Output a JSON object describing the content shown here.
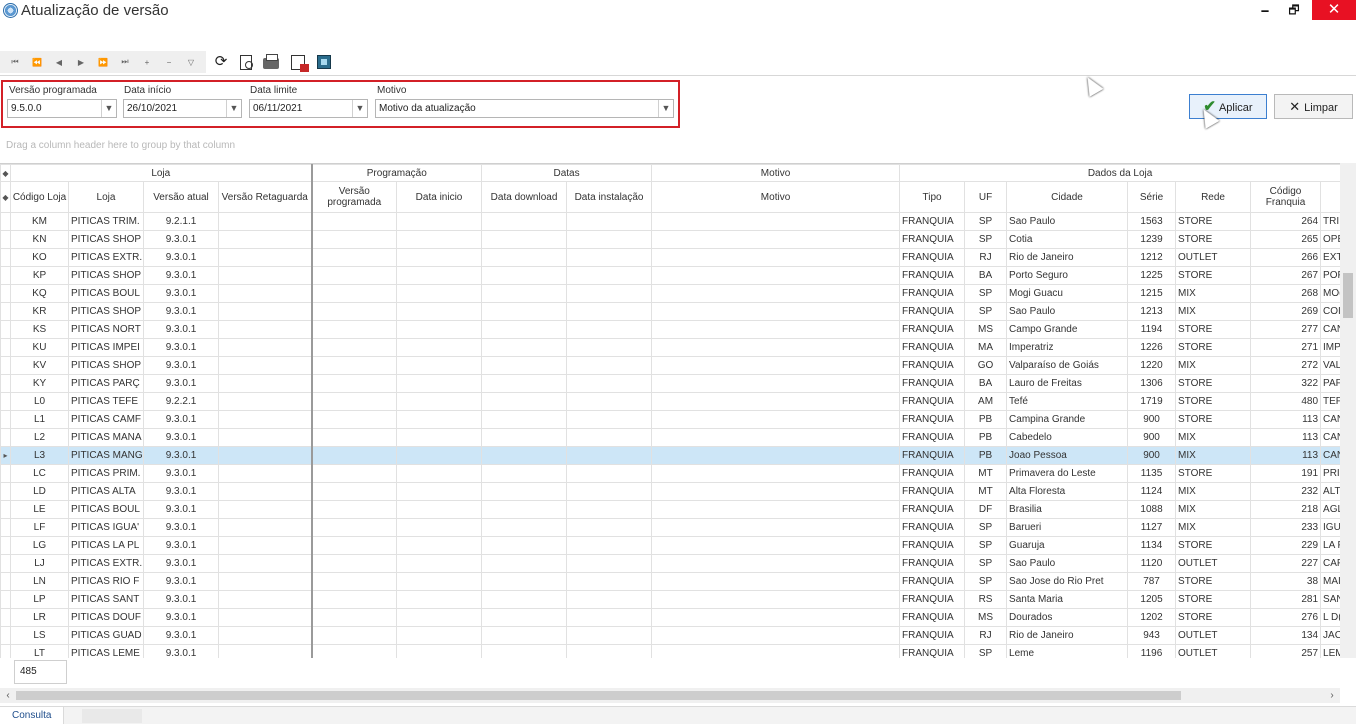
{
  "window": {
    "title": "Atualização de versão",
    "min_glyph": "🗕",
    "max_glyph": "🗗",
    "close_glyph": "✕"
  },
  "toolbar": {
    "nav_buttons": [
      "⏮",
      "⏪",
      "◀",
      "▶",
      "⏩",
      "⏭",
      "+",
      "−",
      "▽"
    ],
    "refresh_glyph": "⟳"
  },
  "filters": {
    "versao_label": "Versão programada",
    "versao_value": "9.5.0.0",
    "data_inicio_label": "Data início",
    "data_inicio_value": "26/10/2021",
    "data_limite_label": "Data limite",
    "data_limite_value": "06/11/2021",
    "motivo_label": "Motivo",
    "motivo_value": "Motivo da atualização"
  },
  "actions": {
    "apply_label": "Aplicar",
    "clear_label": "Limpar"
  },
  "grid": {
    "group_panel_text": "Drag a column header here to group by that column",
    "bands": {
      "loja": "Loja",
      "programacao": "Programação",
      "datas": "Datas",
      "motivo": "Motivo",
      "dados_loja": "Dados da Loja"
    },
    "columns": {
      "codigo_loja": "Código Loja",
      "loja": "Loja",
      "versao_atual": "Versão atual",
      "versao_retaguarda": "Versão Retaguarda",
      "versao_programada": "Versão programada",
      "data_inicio": "Data inicio",
      "data_download": "Data download",
      "data_instalacao": "Data instalação",
      "motivo": "Motivo",
      "tipo": "Tipo",
      "uf": "UF",
      "cidade": "Cidade",
      "serie": "Série",
      "rede": "Rede",
      "codigo_franquia": "Código Franquia"
    },
    "selected_row_index": 13,
    "rows": [
      {
        "codigo": "KM",
        "loja": "PITICAS TRIM.",
        "versao": "9.2.1.1",
        "tipo": "FRANQUIA",
        "uf": "SP",
        "cidade": "Sao Paulo",
        "serie": "1563",
        "rede": "STORE",
        "franquia": "264",
        "extra": "TRI"
      },
      {
        "codigo": "KN",
        "loja": "PITICAS SHOP",
        "versao": "9.3.0.1",
        "tipo": "FRANQUIA",
        "uf": "SP",
        "cidade": "Cotia",
        "serie": "1239",
        "rede": "STORE",
        "franquia": "265",
        "extra": "OPE"
      },
      {
        "codigo": "KO",
        "loja": "PITICAS EXTR.",
        "versao": "9.3.0.1",
        "tipo": "FRANQUIA",
        "uf": "RJ",
        "cidade": "Rio de Janeiro",
        "serie": "1212",
        "rede": "OUTLET",
        "franquia": "266",
        "extra": "EXT"
      },
      {
        "codigo": "KP",
        "loja": "PITICAS SHOP",
        "versao": "9.3.0.1",
        "tipo": "FRANQUIA",
        "uf": "BA",
        "cidade": "Porto Seguro",
        "serie": "1225",
        "rede": "STORE",
        "franquia": "267",
        "extra": "POF"
      },
      {
        "codigo": "KQ",
        "loja": "PITICAS BOUL",
        "versao": "9.3.0.1",
        "tipo": "FRANQUIA",
        "uf": "SP",
        "cidade": "Mogi Guacu",
        "serie": "1215",
        "rede": "MIX",
        "franquia": "268",
        "extra": "MO("
      },
      {
        "codigo": "KR",
        "loja": "PITICAS SHOP",
        "versao": "9.3.0.1",
        "tipo": "FRANQUIA",
        "uf": "SP",
        "cidade": "Sao Paulo",
        "serie": "1213",
        "rede": "MIX",
        "franquia": "269",
        "extra": "COI"
      },
      {
        "codigo": "KS",
        "loja": "PITICAS NORT",
        "versao": "9.3.0.1",
        "tipo": "FRANQUIA",
        "uf": "MS",
        "cidade": "Campo Grande",
        "serie": "1194",
        "rede": "STORE",
        "franquia": "277",
        "extra": "CAN"
      },
      {
        "codigo": "KU",
        "loja": "PITICAS IMPEI",
        "versao": "9.3.0.1",
        "tipo": "FRANQUIA",
        "uf": "MA",
        "cidade": "Imperatriz",
        "serie": "1226",
        "rede": "STORE",
        "franquia": "271",
        "extra": "IMP"
      },
      {
        "codigo": "KV",
        "loja": "PITICAS SHOP",
        "versao": "9.3.0.1",
        "tipo": "FRANQUIA",
        "uf": "GO",
        "cidade": "Valparaíso de Goiás",
        "serie": "1220",
        "rede": "MIX",
        "franquia": "272",
        "extra": "VAL"
      },
      {
        "codigo": "KY",
        "loja": "PITICAS PARÇ",
        "versao": "9.3.0.1",
        "tipo": "FRANQUIA",
        "uf": "BA",
        "cidade": "Lauro de Freitas",
        "serie": "1306",
        "rede": "STORE",
        "franquia": "322",
        "extra": "PAF"
      },
      {
        "codigo": "L0",
        "loja": "PITICAS TEFE",
        "versao": "9.2.2.1",
        "tipo": "FRANQUIA",
        "uf": "AM",
        "cidade": "Tefé",
        "serie": "1719",
        "rede": "STORE",
        "franquia": "480",
        "extra": "TEF"
      },
      {
        "codigo": "L1",
        "loja": "PITICAS CAMF",
        "versao": "9.3.0.1",
        "tipo": "FRANQUIA",
        "uf": "PB",
        "cidade": "Campina Grande",
        "serie": "900",
        "rede": "STORE",
        "franquia": "113",
        "extra": "CAN"
      },
      {
        "codigo": "L2",
        "loja": "PITICAS MANA",
        "versao": "9.3.0.1",
        "tipo": "FRANQUIA",
        "uf": "PB",
        "cidade": "Cabedelo",
        "serie": "900",
        "rede": "MIX",
        "franquia": "113",
        "extra": "CAN"
      },
      {
        "codigo": "L3",
        "loja": "PITICAS MANG",
        "versao": "9.3.0.1",
        "tipo": "FRANQUIA",
        "uf": "PB",
        "cidade": "Joao Pessoa",
        "serie": "900",
        "rede": "MIX",
        "franquia": "113",
        "extra": "CAN"
      },
      {
        "codigo": "LC",
        "loja": "PITICAS PRIM.",
        "versao": "9.3.0.1",
        "tipo": "FRANQUIA",
        "uf": "MT",
        "cidade": "Primavera do Leste",
        "serie": "1135",
        "rede": "STORE",
        "franquia": "191",
        "extra": "PRI"
      },
      {
        "codigo": "LD",
        "loja": "PITICAS ALTA",
        "versao": "9.3.0.1",
        "tipo": "FRANQUIA",
        "uf": "MT",
        "cidade": "Alta Floresta",
        "serie": "1124",
        "rede": "MIX",
        "franquia": "232",
        "extra": "ALT"
      },
      {
        "codigo": "LE",
        "loja": "PITICAS BOUL",
        "versao": "9.3.0.1",
        "tipo": "FRANQUIA",
        "uf": "DF",
        "cidade": "Brasilia",
        "serie": "1088",
        "rede": "MIX",
        "franquia": "218",
        "extra": "AGL"
      },
      {
        "codigo": "LF",
        "loja": "PITICAS IGUA'",
        "versao": "9.3.0.1",
        "tipo": "FRANQUIA",
        "uf": "SP",
        "cidade": "Barueri",
        "serie": "1127",
        "rede": "MIX",
        "franquia": "233",
        "extra": "IGU"
      },
      {
        "codigo": "LG",
        "loja": "PITICAS LA PL",
        "versao": "9.3.0.1",
        "tipo": "FRANQUIA",
        "uf": "SP",
        "cidade": "Guaruja",
        "serie": "1134",
        "rede": "STORE",
        "franquia": "229",
        "extra": "LA F"
      },
      {
        "codigo": "LJ",
        "loja": "PITICAS EXTR.",
        "versao": "9.3.0.1",
        "tipo": "FRANQUIA",
        "uf": "SP",
        "cidade": "Sao Paulo",
        "serie": "1120",
        "rede": "OUTLET",
        "franquia": "227",
        "extra": "CAF"
      },
      {
        "codigo": "LN",
        "loja": "PITICAS RIO F",
        "versao": "9.3.0.1",
        "tipo": "FRANQUIA",
        "uf": "SP",
        "cidade": "Sao Jose do Rio Pret",
        "serie": "787",
        "rede": "STORE",
        "franquia": "38",
        "extra": "MAI"
      },
      {
        "codigo": "LP",
        "loja": "PITICAS SANT",
        "versao": "9.3.0.1",
        "tipo": "FRANQUIA",
        "uf": "RS",
        "cidade": "Santa Maria",
        "serie": "1205",
        "rede": "STORE",
        "franquia": "281",
        "extra": "SAN"
      },
      {
        "codigo": "LR",
        "loja": "PITICAS DOUF",
        "versao": "9.3.0.1",
        "tipo": "FRANQUIA",
        "uf": "MS",
        "cidade": "Dourados",
        "serie": "1202",
        "rede": "STORE",
        "franquia": "276",
        "extra": "L D("
      },
      {
        "codigo": "LS",
        "loja": "PITICAS GUAD",
        "versao": "9.3.0.1",
        "tipo": "FRANQUIA",
        "uf": "RJ",
        "cidade": "Rio de Janeiro",
        "serie": "943",
        "rede": "OUTLET",
        "franquia": "134",
        "extra": "JAC"
      },
      {
        "codigo": "LT",
        "loja": "PITICAS LEME",
        "versao": "9.3.0.1",
        "tipo": "FRANQUIA",
        "uf": "SP",
        "cidade": "Leme",
        "serie": "1196",
        "rede": "OUTLET",
        "franquia": "257",
        "extra": "LEM"
      }
    ]
  },
  "footer": {
    "count": "485",
    "tab_label": "Consulta"
  }
}
